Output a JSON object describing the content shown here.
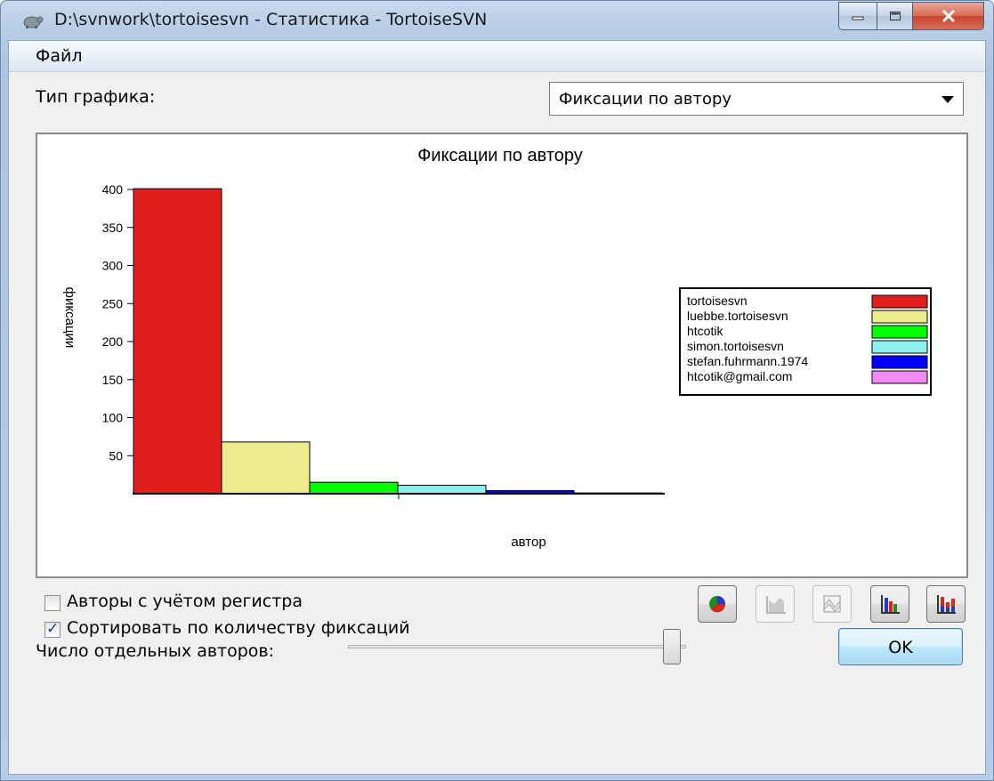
{
  "window": {
    "title": "D:\\svnwork\\tortoisesvn - Статистика - TortoiseSVN"
  },
  "menu": {
    "file_label": "Файл"
  },
  "graph_type": {
    "label": "Тип графика:",
    "selected": "Фиксации по автору"
  },
  "chart_data": {
    "type": "bar",
    "title": "Фиксации по автору",
    "xlabel": "автор",
    "ylabel": "фиксации",
    "ylim": [
      0,
      400
    ],
    "yticks": [
      50,
      100,
      150,
      200,
      250,
      300,
      350,
      400
    ],
    "categories": [
      "tortoisesvn",
      "luebbe.tortoisesvn",
      "htcotik",
      "simon.tortoisesvn",
      "stefan.fuhrmann.1974",
      "htcotik@gmail.com"
    ],
    "values": [
      401,
      68,
      15,
      11,
      4,
      1
    ],
    "colors": [
      "#e01f1f",
      "#eeeb8f",
      "#00ff00",
      "#8ef0ee",
      "#0000ff",
      "#f08af0"
    ],
    "legend_position": "right"
  },
  "options": {
    "case_sensitive_label": "Авторы с учётом регистра",
    "case_sensitive_checked": false,
    "sort_label": "Сортировать по количеству фиксаций",
    "sort_checked": true
  },
  "toolbar": {
    "icons": [
      "pie-chart-icon",
      "area-chart-icon",
      "stacked-chart-icon",
      "bar-chart-icon",
      "stacked-bar-chart-icon"
    ]
  },
  "authors_slider": {
    "label": "Число отдельных авторов:",
    "value_fraction": 1.0
  },
  "buttons": {
    "ok_label": "OK"
  }
}
